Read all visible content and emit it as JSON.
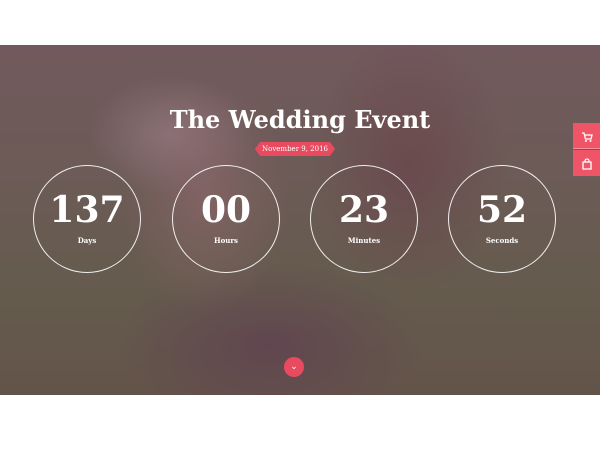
{
  "hero": {
    "title": "The Wedding Event",
    "date": "November 9, 2016"
  },
  "countdown": [
    {
      "value": "137",
      "label": "Days"
    },
    {
      "value": "00",
      "label": "Hours"
    },
    {
      "value": "23",
      "label": "Minutes"
    },
    {
      "value": "52",
      "label": "Seconds"
    }
  ],
  "icons": {
    "scroll_down": "chevron-down-icon",
    "cart": "shopping-cart-icon",
    "bag": "shopping-bag-icon"
  },
  "colors": {
    "accent": "#e84a5f",
    "side_buttons": "#ef5566",
    "overlay": "#5c344e"
  }
}
